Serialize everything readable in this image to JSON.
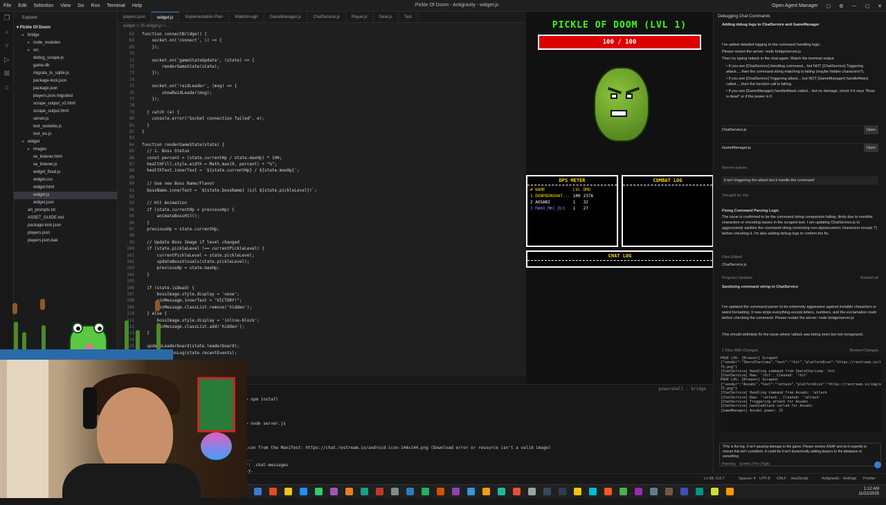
{
  "titlebar": {
    "menu": [
      "File",
      "Edit",
      "Selection",
      "View",
      "Go",
      "Run",
      "Terminal",
      "Help"
    ],
    "window_title": "Pickle Of Doom - Antigravity - widget.js",
    "agent_manager": "Open Agent Manager"
  },
  "explorer": {
    "header": "Explorer",
    "root": "Pickle Of Doom",
    "items": [
      {
        "label": "bridge",
        "type": "folder",
        "depth": 1
      },
      {
        "label": "node_modules",
        "type": "folder",
        "depth": 2
      },
      {
        "label": "src",
        "type": "folder",
        "depth": 2
      },
      {
        "label": "debug_scrape.js",
        "type": "file",
        "depth": 2
      },
      {
        "label": "game.db",
        "type": "file",
        "depth": 2
      },
      {
        "label": "migrate_to_sqlite.js",
        "type": "file",
        "depth": 2
      },
      {
        "label": "package-lock.json",
        "type": "file",
        "depth": 2
      },
      {
        "label": "package.json",
        "type": "file",
        "depth": 2
      },
      {
        "label": "players.json.migrated",
        "type": "file",
        "depth": 2
      },
      {
        "label": "scrape_output_v2.html",
        "type": "file",
        "depth": 2
      },
      {
        "label": "scrape_output.html",
        "type": "file",
        "depth": 2
      },
      {
        "label": "server.js",
        "type": "file",
        "depth": 2
      },
      {
        "label": "test_socketio.js",
        "type": "file",
        "depth": 2
      },
      {
        "label": "test_ws.js",
        "type": "file",
        "depth": 2
      },
      {
        "label": "widget",
        "type": "folder",
        "depth": 1
      },
      {
        "label": "images",
        "type": "folder",
        "depth": 2
      },
      {
        "label": "se_listener.html",
        "type": "file",
        "depth": 2
      },
      {
        "label": "se_listener.js",
        "type": "file",
        "depth": 2
      },
      {
        "label": "widget_fixed.js",
        "type": "file",
        "depth": 2
      },
      {
        "label": "widget.css",
        "type": "file",
        "depth": 2
      },
      {
        "label": "widget.html",
        "type": "file",
        "depth": 2
      },
      {
        "label": "widget.js",
        "type": "file",
        "depth": 2,
        "selected": true
      },
      {
        "label": "widget.json",
        "type": "file",
        "depth": 2
      },
      {
        "label": "art_prompts.txt",
        "type": "file",
        "depth": 1
      },
      {
        "label": "ASSET_GUIDE.md",
        "type": "file",
        "depth": 1
      },
      {
        "label": "package-lock.json",
        "type": "file",
        "depth": 1
      },
      {
        "label": "players.json",
        "type": "file",
        "depth": 1
      },
      {
        "label": "players.json.bak",
        "type": "file",
        "depth": 1
      }
    ]
  },
  "tabs": [
    "players.json",
    "widget.js",
    "Implementation Plan",
    "Walkthrough",
    "GameManager.js",
    "ChatService.js",
    "Player.js",
    "Gear.js",
    "Test"
  ],
  "breadcrumbs": "widget > JS widget.js > ...",
  "editor": {
    "lines": [
      {
        "n": "62",
        "t": "function connectBridge() {"
      },
      {
        "n": "63",
        "t": "    socket.on('connect', () => {"
      },
      {
        "n": "69",
        "t": "    });"
      },
      {
        "n": "70",
        "t": ""
      },
      {
        "n": "71",
        "t": "    socket.on('gameStateUpdate', (state) => {"
      },
      {
        "n": "72",
        "t": "        renderGameState(state);"
      },
      {
        "n": "73",
        "t": "    });"
      },
      {
        "n": "74",
        "t": ""
      },
      {
        "n": "75",
        "t": "    socket.on('raidLeader', (msg) => {"
      },
      {
        "n": "76",
        "t": "        showRaidLeader(msg);"
      },
      {
        "n": "77",
        "t": "    });"
      },
      {
        "n": "78",
        "t": ""
      },
      {
        "n": "79",
        "t": "  } catch (e) {"
      },
      {
        "n": "80",
        "t": "    console.error(\"Socket connection failed\", e);"
      },
      {
        "n": "81",
        "t": "  }"
      },
      {
        "n": "82",
        "t": "}"
      },
      {
        "n": "83",
        "t": ""
      },
      {
        "n": "84",
        "t": "function renderGameState(state) {"
      },
      {
        "n": "85",
        "t": "  // 1. Boss Status"
      },
      {
        "n": "86",
        "t": "  const percent = (state.currentHp / state.maxHp) * 100;"
      },
      {
        "n": "87",
        "t": "  healthFill.style.width = Math.max(0, percent) + \"%\";"
      },
      {
        "n": "88",
        "t": "  healthText.innerText = `${state.currentHp} / ${state.maxHp}`;"
      },
      {
        "n": "89",
        "t": ""
      },
      {
        "n": "90",
        "t": "  // Use new Boss Name/Flavor"
      },
      {
        "n": "91",
        "t": "  bossName.innerText = `${state.bossName} (Lvl ${state.pickleLevel})`;"
      },
      {
        "n": "92",
        "t": ""
      },
      {
        "n": "93",
        "t": "  // Hit Animation"
      },
      {
        "n": "94",
        "t": "  if (state.currentHp < previousHp) {"
      },
      {
        "n": "95",
        "t": "      animateBossHit();"
      },
      {
        "n": "96",
        "t": "  }"
      },
      {
        "n": "97",
        "t": "  previousHp = state.currentHp;"
      },
      {
        "n": "98",
        "t": ""
      },
      {
        "n": "99",
        "t": "  // Update Boss Image if level changed"
      },
      {
        "n": "100",
        "t": "  if (state.pickleLevel !== currentPickleLevel) {"
      },
      {
        "n": "101",
        "t": "      currentPickleLevel = state.pickleLevel;"
      },
      {
        "n": "102",
        "t": "      updateBossVisuals(state.pickleLevel);"
      },
      {
        "n": "103",
        "t": "      previousHp = state.maxHp;"
      },
      {
        "n": "104",
        "t": "  }"
      },
      {
        "n": "105",
        "t": ""
      },
      {
        "n": "106",
        "t": "  if (state.isDead) {"
      },
      {
        "n": "107",
        "t": "      bossImage.style.display = 'none';"
      },
      {
        "n": "108",
        "t": "      winMessage.innerText = \"VICTORY!\";"
      },
      {
        "n": "109",
        "t": "      winMessage.classList.remove('hidden');"
      },
      {
        "n": "110",
        "t": "  } else {"
      },
      {
        "n": "111",
        "t": "      bossImage.style.display = 'inline-block';"
      },
      {
        "n": "112",
        "t": "      winMessage.classList.add('hidden');"
      },
      {
        "n": "113",
        "t": "  }"
      },
      {
        "n": "114",
        "t": ""
      },
      {
        "n": "115",
        "t": "  updateLeaderboard(state.leaderboard);"
      },
      {
        "n": "116",
        "t": "  updateActionLog(state.recentEvents);"
      }
    ]
  },
  "terminal": {
    "header": "powershell - bridge",
    "lines": [
      "> npm install",
      "> node server.js",
      "icon from the Manifest: https://chat.restream.io/android-icon-144x144.png (Download error or resource isn't a valid image)",
      "...",
      "r: .chat-messages",
      "ly."
    ]
  },
  "game": {
    "title": "PICKLE OF DOOM (LVL 1)",
    "hp_text": "100 / 100",
    "hp_fraction": 1.0,
    "dps_meter": {
      "title": "DPS METER",
      "headers": [
        "# NAME",
        "LVL",
        "DMG"
      ],
      "rows": [
        {
          "rank": "1",
          "name": "DONPBONGHAT...",
          "lvl": "100",
          "dmg": "2376",
          "color": "#ffd700"
        },
        {
          "rank": "2",
          "name": "AOSABI",
          "lvl": "1",
          "dmg": "32",
          "color": "#ffffff"
        },
        {
          "rank": "3",
          "name": "MAKO_MKC_DLS",
          "lvl": "1",
          "dmg": "27",
          "color": "#a070ff"
        }
      ]
    },
    "combat_log_title": "COMBAT LOG",
    "chat_log_title": "CHAT LOG"
  },
  "agent": {
    "header": "Debugging Chat Commands",
    "task_title": "Adding debug logs to ChatService and GameManager",
    "msg1": "I've added detailed logging to the command handling logic.",
    "msg2": "Please restart the server: node bridge/server.js",
    "msg3": "Then try typing !attack in the chat again. Watch the terminal output.",
    "bullets": [
      "If you see [ChatService] Handling command... but NOT [ChatService] Triggering attack..., then the command string matching is failing (maybe hidden characters?).",
      "If you see [ChatService] Triggering attack... but NOT [GameManager] handleAttack called..., then the function call is failing.",
      "If you see [GameManager] handleAttack called... but no damage, check if it says \"Boss is dead\" or if the power is 0."
    ],
    "files": [
      "ChatService.js",
      "GameManager.js"
    ],
    "open_label": "Open",
    "recent_actions": "Recent actions",
    "user_msg": "it isn't triggering the attack but it handle the command",
    "thought": "Thought for 10s",
    "fix_title": "Fixing Command Parsing Logic",
    "fix_body": "The issue is confirmed to be the command string comparison failing, likely due to invisible characters or encoding issues in the scraped text. I am updating ChatService.js to aggressively sanitize the command string (removing non-alphanumeric characters except '!') before checking it. I'm also adding debug logs to confirm the fix.",
    "files_edited": "Files Edited",
    "edited_file": "ChatService.js",
    "progress_updates": "Progress Updates",
    "expand_all": "Expand all",
    "progress_item": "Sanitizing command string in ChatService",
    "final_msg": "I've updated the command parser to be extremely aggressive against invisible characters or weird formatting. It now strips everything except letters, numbers, and the exclamation mark before checking the command. Please restart the server: node bridge/server.js",
    "final_msg2": "This should definitely fix the issue where !attack was being seen but not recognized.",
    "files_with_changes": "1 Files With Changes",
    "review_changes": "Review Changes",
    "log_lines": [
      "PAGE LOG: [Browser] Scraped:",
      "{\"sender\":\"ZeeroCharisma\",\"text\":\"!hit\",\"platformIcon\":\"https://restream.io/img/api/platforms/platform-75.png\"}",
      "[ChatService] Handling command from ZeeroCharisma: !hit",
      "[ChatService] Raw: '!hit', Cleaned: '!hit'",
      "PAGE LOG: [Browser] Scraped:",
      "{\"sender\":\"Aosabi\",\"text\":\"!attack\",\"platformIcon\":\"https://restream.io/img/api/platforms/platform-75.png\"}",
      "[ChatService] Handling command from Aosabi: !attack",
      "[ChatService] Raw: '!attack', Cleaned: '!attack'",
      "[ChatService] Triggering attack for Aosabi",
      "[ChatService] handleAttack called for Aosabi",
      "[GameManager] Aosabi power: 15"
    ],
    "input_text": "THis is the log. It isn't passing damage to the game. Please resolve ASAP and do it expertly to ensure this isn't a problem. It could be it isn't dynamically adding players to the database or something",
    "planning": "Planning",
    "model": "Gemini 3 Pro (High)"
  },
  "status": {
    "position": "Ln 58, Col 7",
    "spaces": "Spaces: 4",
    "encoding": "UTF-8",
    "eol": "CRLF",
    "language": "JavaScript",
    "settings": "Antigravity - Settings",
    "prettier": "Prettier"
  },
  "clock": {
    "time": "1:12 AM",
    "date": "11/22/2025"
  }
}
